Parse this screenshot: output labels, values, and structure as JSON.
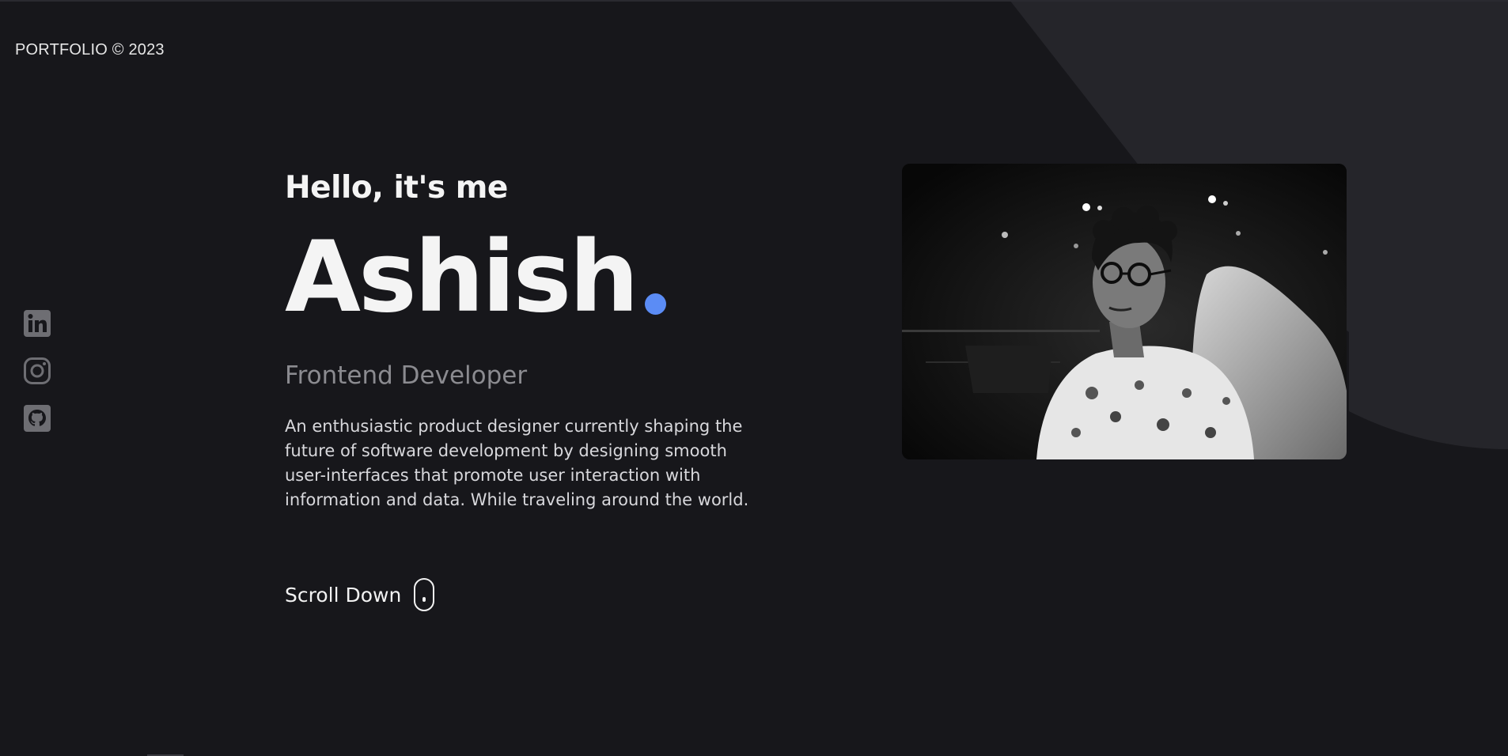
{
  "brand": {
    "text": "PORTFOLIO © 2023"
  },
  "socials": [
    {
      "name": "LinkedIn",
      "icon": "linkedin-icon"
    },
    {
      "name": "Instagram",
      "icon": "instagram-icon"
    },
    {
      "name": "GitHub",
      "icon": "github-icon"
    }
  ],
  "hero": {
    "greeting": "Hello, it's me",
    "name": "Ashish",
    "role": "Frontend Developer",
    "bio": "An enthusiastic product designer currently shaping the future of software development by designing smooth user-interfaces that promote user interaction with information and data. While traveling around the world.",
    "scroll_label": "Scroll Down"
  },
  "colors": {
    "background": "#17171b",
    "background_shape": "#25252a",
    "accent": "#5b8cf5",
    "text": "#f4f4f4",
    "muted": "#8b8b90",
    "social_icon": "#6e6e73"
  }
}
